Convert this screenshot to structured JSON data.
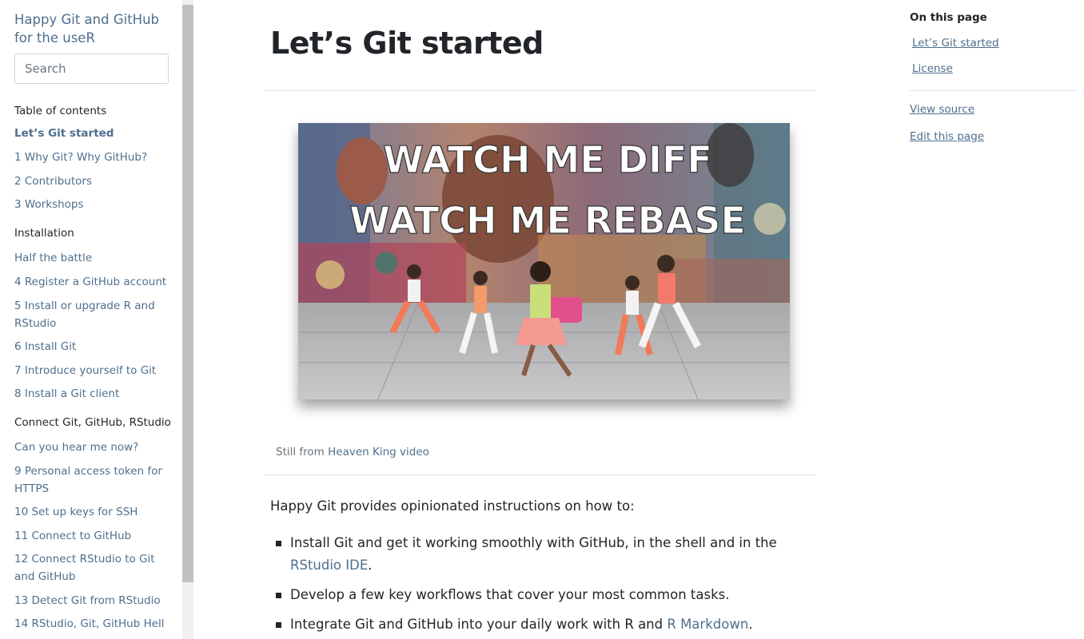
{
  "sidebar": {
    "book_title": "Happy Git and GitHub for the useR",
    "search_placeholder": "Search",
    "toc_heading": "Table of contents",
    "items": [
      {
        "label": "Let’s Git started",
        "type": "active"
      },
      {
        "label": "1 Why Git? Why GitHub?",
        "type": "link"
      },
      {
        "label": "2 Contributors",
        "type": "link"
      },
      {
        "label": "3 Workshops",
        "type": "link"
      },
      {
        "label": "Installation",
        "type": "part"
      },
      {
        "label": "Half the battle",
        "type": "link"
      },
      {
        "label": "4 Register a GitHub account",
        "type": "link"
      },
      {
        "label": "5 Install or upgrade R and RStudio",
        "type": "link"
      },
      {
        "label": "6 Install Git",
        "type": "link"
      },
      {
        "label": "7 Introduce yourself to Git",
        "type": "link"
      },
      {
        "label": "8 Install a Git client",
        "type": "link"
      },
      {
        "label": "Connect Git, GitHub, RStudio",
        "type": "part"
      },
      {
        "label": "Can you hear me now?",
        "type": "link"
      },
      {
        "label": "9 Personal access token for HTTPS",
        "type": "link"
      },
      {
        "label": "10 Set up keys for SSH",
        "type": "link"
      },
      {
        "label": "11 Connect to GitHub",
        "type": "link"
      },
      {
        "label": "12 Connect RStudio to Git and GitHub",
        "type": "link"
      },
      {
        "label": "13 Detect Git from RStudio",
        "type": "link"
      },
      {
        "label": "14 RStudio, Git, GitHub Hell",
        "type": "link"
      }
    ]
  },
  "main": {
    "title": "Let’s Git started",
    "image": {
      "line1": "WATCH ME DIFF",
      "line2": "WATCH ME REBASE"
    },
    "caption_prefix": "Still from ",
    "caption_link": "Heaven King video",
    "intro": "Happy Git provides opinionated instructions on how to:",
    "bullets": [
      {
        "before": "Install Git and get it working smoothly with GitHub, in the shell and in the ",
        "link": "RStudio IDE",
        "after": "."
      },
      {
        "before": "Develop a few key workflows that cover your most common tasks.",
        "link": "",
        "after": ""
      },
      {
        "before": "Integrate Git and GitHub into your daily work with R and ",
        "link": "R Markdown",
        "after": "."
      }
    ]
  },
  "right_nav": {
    "title": "On this page",
    "links": [
      "Let’s Git started",
      "License"
    ],
    "view_source": "View source",
    "edit_page": "Edit this page"
  },
  "colors": {
    "link": "#4e6f8e",
    "text": "#212529",
    "muted": "#6c757d",
    "rule": "#dee2e6"
  }
}
